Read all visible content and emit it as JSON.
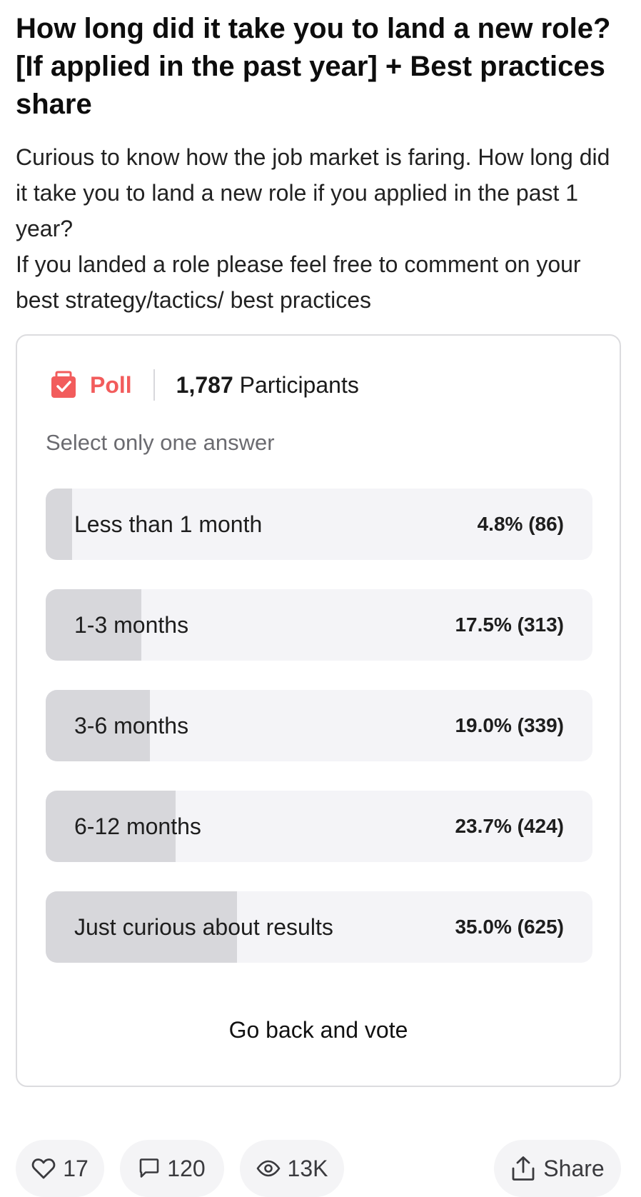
{
  "post": {
    "title": "How long did it take you to land a new role? [If applied in the past year] + Best practices share",
    "body_line_1": "Curious to know how the job market is faring. How long did it take you to land a new role if you applied in the past 1 year?",
    "body_line_2": "If you landed a role please feel free to comment on your best strategy/tactics/ best practices"
  },
  "poll": {
    "icon": "poll-icon",
    "label": "Poll",
    "participants_count": "1,787",
    "participants_label": "Participants",
    "instruction": "Select only one answer",
    "accent_color": "#f25c5c",
    "options": [
      {
        "label": "Less than 1 month",
        "result": "4.8% (86)",
        "percent": 4.8
      },
      {
        "label": "1-3 months",
        "result": "17.5% (313)",
        "percent": 17.5
      },
      {
        "label": "3-6 months",
        "result": "19.0% (339)",
        "percent": 19.0
      },
      {
        "label": "6-12 months",
        "result": "23.7% (424)",
        "percent": 23.7
      },
      {
        "label": "Just curious about results",
        "result": "35.0% (625)",
        "percent": 35.0
      }
    ],
    "go_back_label": "Go back and vote"
  },
  "footer": {
    "likes": "17",
    "comments": "120",
    "views": "13K",
    "share_label": "Share",
    "icons": [
      "heart-icon",
      "comment-icon",
      "eye-icon",
      "share-icon"
    ]
  }
}
